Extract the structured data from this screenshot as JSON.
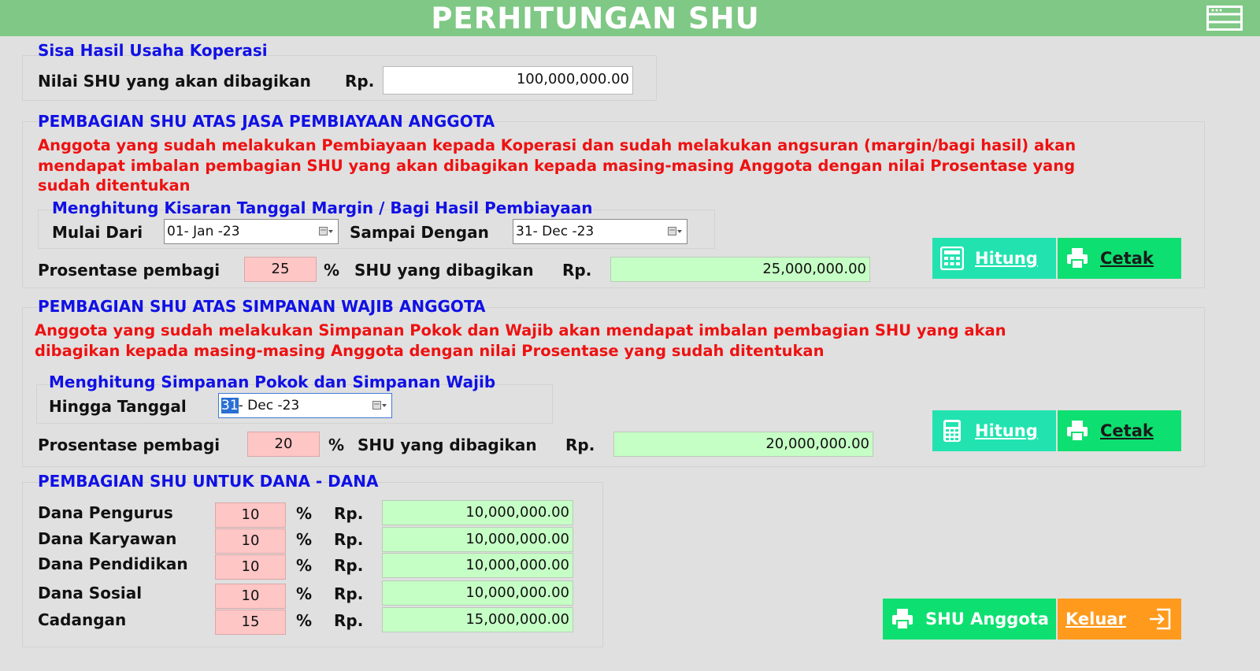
{
  "window": {
    "title": "PERHITUNGAN SHU"
  },
  "shu": {
    "section_title": "Sisa Hasil Usaha Koperasi",
    "label": "Nilai SHU yang akan dibagikan",
    "currency": "Rp.",
    "value": "100,000,000.00"
  },
  "jasa": {
    "section_title": "PEMBAGIAN SHU ATAS JASA PEMBIAYAAN ANGGOTA",
    "note_1": "Anggota yang sudah melakukan Pembiayaan kepada Koperasi dan sudah melakukan angsuran (margin/bagi hasil) akan",
    "note_2": "mendapat imbalan pembagian SHU yang akan dibagikan kepada masing-masing Anggota dengan nilai Prosentase yang",
    "note_3": "sudah ditentukan",
    "sub_title": "Menghitung Kisaran Tanggal Margin / Bagi Hasil Pembiayaan",
    "from_label": "Mulai Dari",
    "from_value": "01- Jan -23",
    "to_label": "Sampai Dengan",
    "to_value": "31- Dec -23",
    "pct_label": "Prosentase pembagi",
    "pct_value": "25",
    "pct_sign": "%",
    "shu_label": "SHU yang dibagikan",
    "currency": "Rp.",
    "shu_value": "25,000,000.00",
    "hitung_label": "Hitung",
    "cetak_label": "Cetak"
  },
  "wajib": {
    "section_title": "PEMBAGIAN SHU ATAS SIMPANAN WAJIB ANGGOTA",
    "note_1": "Anggota yang sudah melakukan Simpanan Pokok dan Wajib akan mendapat imbalan pembagian SHU yang akan",
    "note_2": "dibagikan kepada masing-masing Anggota dengan nilai Prosentase yang sudah ditentukan",
    "sub_title": "Menghitung Simpanan Pokok dan Simpanan Wajib",
    "until_label": "Hingga Tanggal",
    "until_day": "31",
    "until_rest": "- Dec -23",
    "pct_label": "Prosentase pembagi",
    "pct_value": "20",
    "pct_sign": "%",
    "shu_label": "SHU yang dibagikan",
    "currency": "Rp.",
    "shu_value": "20,000,000.00",
    "hitung_label": "Hitung",
    "cetak_label": "Cetak"
  },
  "dana": {
    "section_title": "PEMBAGIAN SHU UNTUK DANA - DANA",
    "pct_sign": "%",
    "currency": "Rp.",
    "rows": [
      {
        "label": "Dana Pengurus",
        "pct": "10",
        "value": "10,000,000.00"
      },
      {
        "label": "Dana Karyawan",
        "pct": "10",
        "value": "10,000,000.00"
      },
      {
        "label": "Dana Pendidikan",
        "pct": "10",
        "value": "10,000,000.00"
      },
      {
        "label": "Dana Sosial",
        "pct": "10",
        "value": "10,000,000.00"
      },
      {
        "label": "Cadangan",
        "pct": "15",
        "value": "15,000,000.00"
      }
    ]
  },
  "footer": {
    "shu_anggota_label": "SHU Anggota",
    "keluar_label": "Keluar"
  },
  "colors": {
    "title_bar": "#7fc885",
    "section_title": "#1010e6",
    "note_text": "#ee1111",
    "input_pink": "#ffc6c6",
    "output_green": "#c6ffc6",
    "button_teal": "#22e3b0",
    "button_green": "#0de070",
    "button_orange": "#ff9a1c"
  },
  "icons": [
    "window-icon",
    "calendar-icon",
    "calculator-icon",
    "printer-icon",
    "exit-icon"
  ]
}
